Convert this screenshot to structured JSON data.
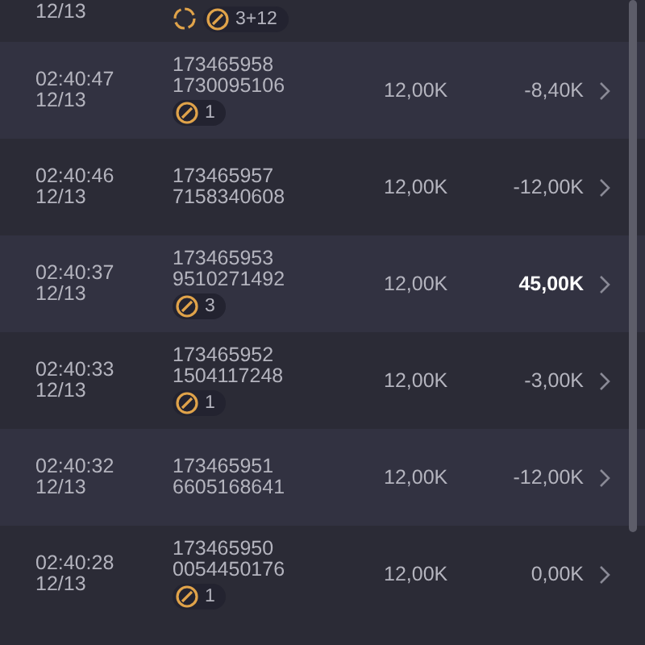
{
  "rows": [
    {
      "date": "12/13",
      "pending": true,
      "badge": "3+12"
    },
    {
      "time": "02:40:47",
      "date": "12/13",
      "ids": [
        "173465958",
        "1730095106"
      ],
      "badge": "1",
      "bet": "12,00K",
      "result": "-8,40K",
      "highlighted": false
    },
    {
      "time": "02:40:46",
      "date": "12/13",
      "ids": [
        "173465957",
        "7158340608"
      ],
      "bet": "12,00K",
      "result": "-12,00K",
      "highlighted": false
    },
    {
      "time": "02:40:37",
      "date": "12/13",
      "ids": [
        "173465953",
        "9510271492"
      ],
      "badge": "3",
      "bet": "12,00K",
      "result": "45,00K",
      "highlighted": true
    },
    {
      "time": "02:40:33",
      "date": "12/13",
      "ids": [
        "173465952",
        "1504117248"
      ],
      "badge": "1",
      "bet": "12,00K",
      "result": "-3,00K",
      "highlighted": false
    },
    {
      "time": "02:40:32",
      "date": "12/13",
      "ids": [
        "173465951",
        "6605168641"
      ],
      "bet": "12,00K",
      "result": "-12,00K",
      "highlighted": false
    },
    {
      "time": "02:40:28",
      "date": "12/13",
      "ids": [
        "173465950",
        "0054450176"
      ],
      "badge": "1",
      "bet": "12,00K",
      "result": "0,00K",
      "highlighted": false
    }
  ]
}
